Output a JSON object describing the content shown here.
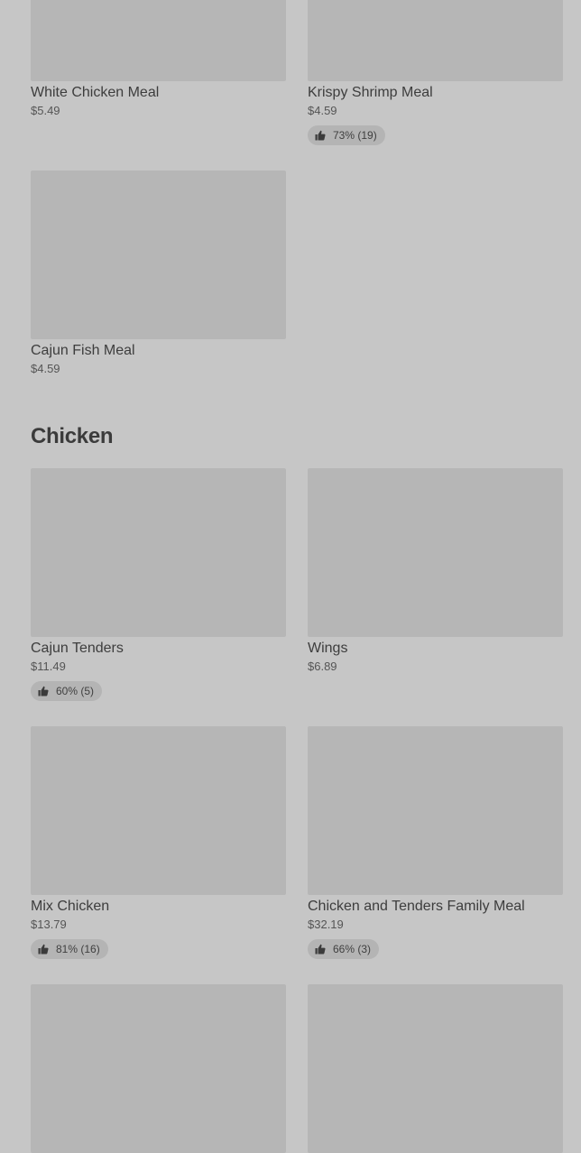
{
  "items_top": [
    {
      "name": "White Chicken Meal",
      "price": "$5.49"
    },
    {
      "name": "Krispy Shrimp Meal",
      "price": "$4.59",
      "rating": "73% (19)"
    },
    {
      "name": "Cajun Fish Meal",
      "price": "$4.59"
    }
  ],
  "section": {
    "title": "Chicken"
  },
  "chicken_items": [
    {
      "name": "Cajun Tenders",
      "price": "$11.49",
      "rating": "60% (5)"
    },
    {
      "name": "Wings",
      "price": "$6.89"
    },
    {
      "name": "Mix Chicken",
      "price": "$13.79",
      "rating": "81% (16)"
    },
    {
      "name": "Chicken and Tenders Family Meal",
      "price": "$32.19",
      "rating": "66% (3)"
    }
  ],
  "icons": {
    "rating": "thumbs-up-icon"
  },
  "colors": {
    "background": "#c6c6c6",
    "image_placeholder": "#b6b6b6",
    "badge": "#b4b4b4",
    "text": "#3b3b3b"
  }
}
